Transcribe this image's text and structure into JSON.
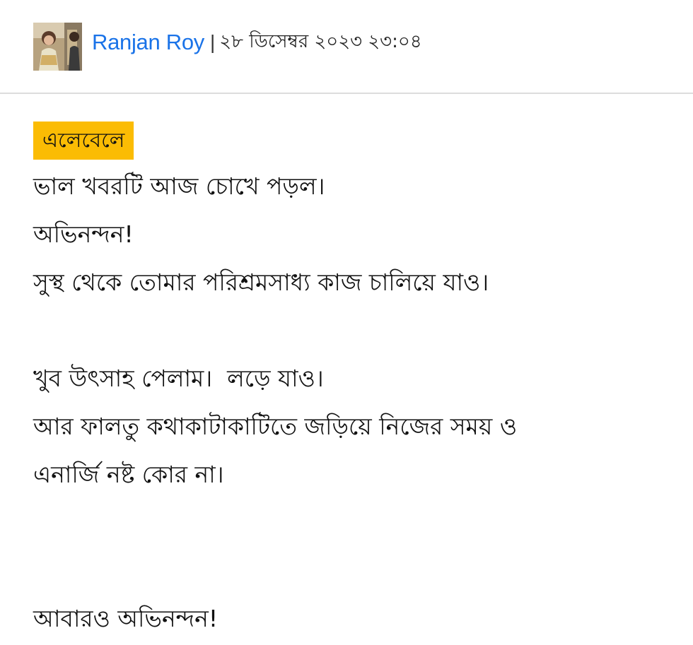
{
  "comment": {
    "author": "Ranjan Roy",
    "separator": "|",
    "timestamp": "২৮ ডিসেম্বর ২০২৩ ২৩:০৪",
    "tag": "এলেবেলে",
    "lines": {
      "l1": "ভাল খবরটি আজ চোখে পড়ল।",
      "l2": "অভিনন্দন!",
      "l3": "সুস্থ থেকে তোমার পরিশ্রমসাধ্য কাজ চালিয়ে যাও।",
      "l4": "খুব উৎসাহ পেলাম।  লড়ে যাও।",
      "l5": "আর ফালতু কথাকাটাকাটিতে জড়িয়ে নিজের সময় ও",
      "l6": "এনার্জি নষ্ট কোর না।",
      "l7": "আবারও অভিনন্দন!"
    }
  },
  "colors": {
    "author_link": "#1a73e8",
    "tag_background": "#fbbc04",
    "divider": "#dddddd"
  },
  "icons": {
    "avatar": "user-photo"
  }
}
